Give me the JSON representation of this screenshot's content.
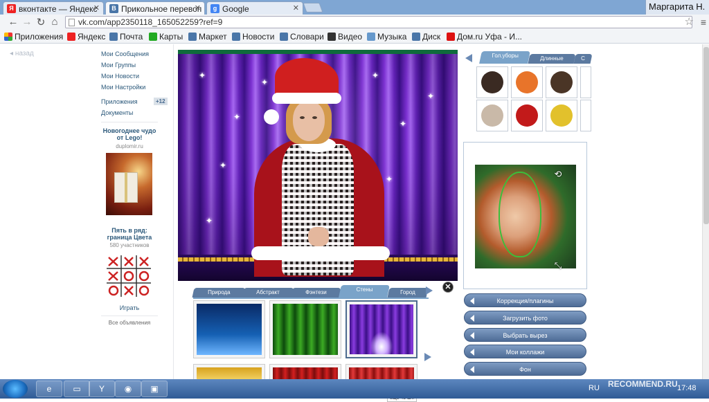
{
  "browser": {
    "tabs": [
      {
        "label": "вконтакте — Яндекс",
        "fav": "Я",
        "color": "#e22"
      },
      {
        "label": "Прикольное перевоп",
        "fav": "B",
        "color": "#4a76a8"
      },
      {
        "label": "Google",
        "fav": "g",
        "color": "#4285f4"
      }
    ],
    "user": "Маргарита Н.",
    "url": "vk.com/app2350118_165052259?ref=9",
    "bookmarks": [
      "Приложения",
      "Яндекс",
      "Почта",
      "Карты",
      "Маркет",
      "Новости",
      "Словари",
      "Видео",
      "Музыка",
      "Диск",
      "Дом.ru Уфа - И..."
    ]
  },
  "sidebar": {
    "back": "назад",
    "items": [
      "Мои Сообщения",
      "Мои Группы",
      "Мои Новости",
      "Мои Настройки",
      "Приложения",
      "Документы"
    ],
    "apps_badge": "+12",
    "ad1": {
      "title": "Новогоднее чудо от Lego!",
      "sub": "duplomir.ru"
    },
    "ad2": {
      "title": "Пять в ряд: граница Цвета",
      "sub": "580 участников"
    },
    "play": "Играть",
    "all_ads": "Все объявления"
  },
  "editor": {
    "bg_tabs": [
      "Природа",
      "Абстракт",
      "Фэнтези",
      "Стены",
      "Город"
    ],
    "active_bg_tab": "Стены",
    "more_tip": "еще 45 шт.",
    "acc_tabs": [
      "Гол.уборы",
      "Длинные",
      "С"
    ],
    "buttons": [
      "Коррекция/плагины",
      "Загрузить фото",
      "Выбрать вырез",
      "Мои коллажи",
      "Фон"
    ]
  },
  "taskbar": {
    "lang": "RU",
    "time": "17:48",
    "watermark": "RECOMMEND.RU"
  },
  "colors": {
    "vk_link": "#2b587a",
    "button_blue": "#5c7aa0",
    "curtain_purple": "#7b2fd1"
  }
}
